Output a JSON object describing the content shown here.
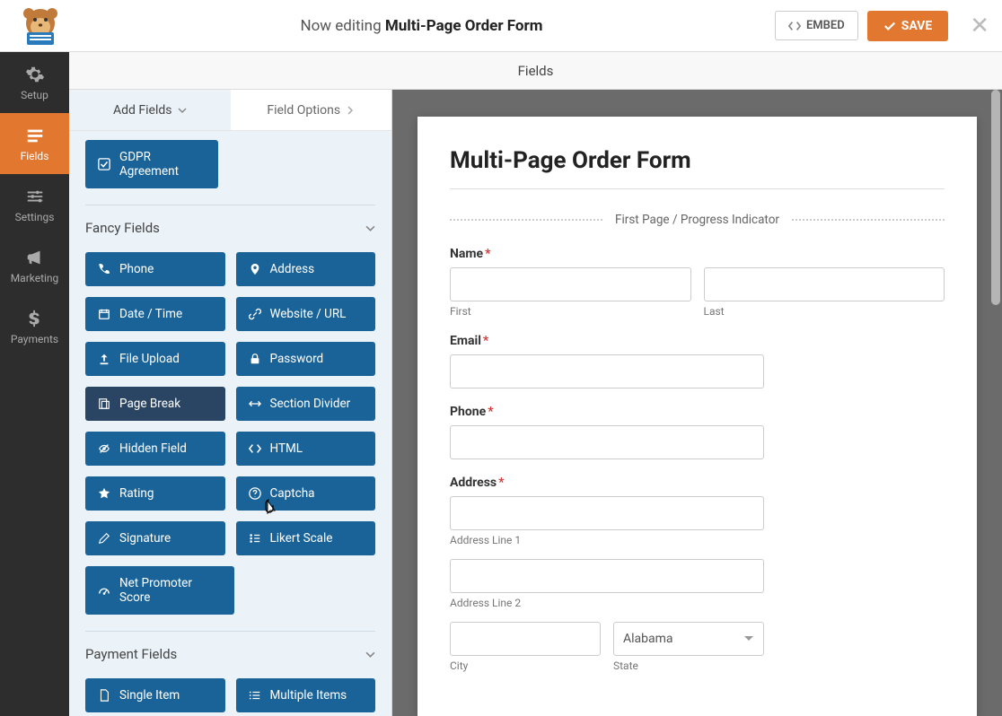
{
  "header": {
    "editing_prefix": "Now editing ",
    "form_name": "Multi-Page Order Form",
    "embed_label": "EMBED",
    "save_label": "SAVE"
  },
  "sidenav": {
    "setup": "Setup",
    "fields": "Fields",
    "settings": "Settings",
    "marketing": "Marketing",
    "payments": "Payments"
  },
  "panel_title": "Fields",
  "tabs": {
    "add_fields": "Add Fields",
    "field_options": "Field Options"
  },
  "gdpr": {
    "label": "GDPR Agreement"
  },
  "fancy_title": "Fancy Fields",
  "fancy": {
    "phone": "Phone",
    "address": "Address",
    "datetime": "Date / Time",
    "url": "Website / URL",
    "upload": "File Upload",
    "password": "Password",
    "pagebreak": "Page Break",
    "section": "Section Divider",
    "hidden": "Hidden Field",
    "html": "HTML",
    "rating": "Rating",
    "captcha": "Captcha",
    "signature": "Signature",
    "likert": "Likert Scale",
    "nps": "Net Promoter Score"
  },
  "payment_title": "Payment Fields",
  "payment": {
    "single": "Single Item",
    "multiple": "Multiple Items"
  },
  "form": {
    "title": "Multi-Page Order Form",
    "divider": "First Page / Progress Indicator",
    "name_label": "Name",
    "first_sub": "First",
    "last_sub": "Last",
    "email_label": "Email",
    "phone_label": "Phone",
    "address_label": "Address",
    "line1_sub": "Address Line 1",
    "line2_sub": "Address Line 2",
    "city_sub": "City",
    "state_sub": "State",
    "state_value": "Alabama"
  }
}
